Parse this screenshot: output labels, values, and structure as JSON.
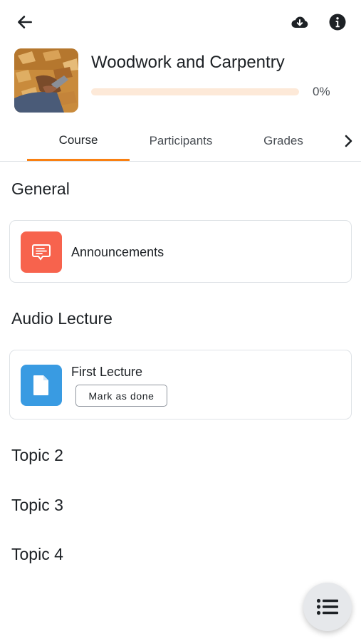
{
  "course": {
    "title": "Woodwork and Carpentry",
    "progress_percent": 0,
    "progress_label": "0%"
  },
  "tabs": [
    {
      "label": "Course",
      "active": true
    },
    {
      "label": "Participants",
      "active": false
    },
    {
      "label": "Grades",
      "active": false
    }
  ],
  "sections": [
    {
      "title": "General",
      "activities": [
        {
          "name": "Announcements",
          "icon": "forum-icon"
        }
      ]
    },
    {
      "title": "Audio Lecture",
      "activities": [
        {
          "name": "First Lecture",
          "icon": "file-icon",
          "button": "Mark as done"
        }
      ]
    },
    {
      "title": "Topic 2"
    },
    {
      "title": "Topic 3"
    },
    {
      "title": "Topic 4"
    }
  ],
  "colors": {
    "accent": "#f98012",
    "progress_track": "#fde9d8",
    "forum_icon_bg": "#f7634d",
    "file_icon_bg": "#399be2"
  },
  "icons": {
    "back": "arrow-left-icon",
    "download": "cloud-download-icon",
    "info": "info-icon",
    "next_tab": "chevron-right-icon",
    "fab": "list-icon"
  }
}
